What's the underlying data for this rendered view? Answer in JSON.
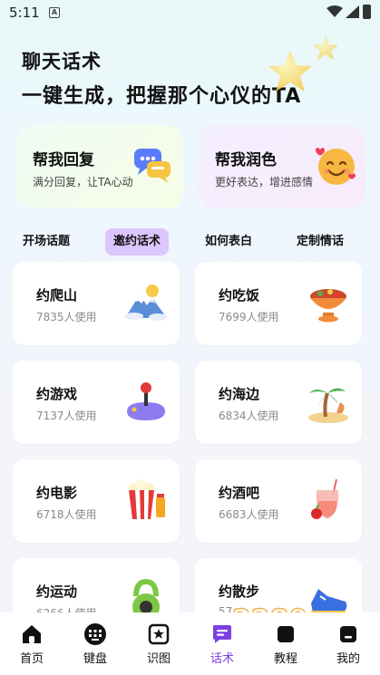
{
  "status": {
    "time": "5:11",
    "a_badge": "A"
  },
  "header": {
    "title": "聊天话术",
    "subtitle": "一键生成，把握那个心仪的TA"
  },
  "features": [
    {
      "title": "帮我回复",
      "subtitle": "满分回复，让TA心动",
      "icon": "chat-bubbles-icon"
    },
    {
      "title": "帮我润色",
      "subtitle": "更好表达，增进感情",
      "icon": "smiling-face-icon"
    }
  ],
  "tabs": [
    {
      "label": "开场话题",
      "active": false
    },
    {
      "label": "邀约话术",
      "active": true
    },
    {
      "label": "如何表白",
      "active": false
    },
    {
      "label": "定制情话",
      "active": false
    }
  ],
  "topics": [
    {
      "title": "约爬山",
      "count": "7835人使用",
      "icon": "mountain-icon"
    },
    {
      "title": "约吃饭",
      "count": "7699人使用",
      "icon": "food-bowl-icon"
    },
    {
      "title": "约游戏",
      "count": "7137人使用",
      "icon": "joystick-icon"
    },
    {
      "title": "约海边",
      "count": "6834人使用",
      "icon": "palm-tree-icon"
    },
    {
      "title": "约电影",
      "count": "6718人使用",
      "icon": "popcorn-icon"
    },
    {
      "title": "约酒吧",
      "count": "6683人使用",
      "icon": "drink-icon"
    },
    {
      "title": "约运动",
      "count": "6266人使用",
      "icon": "kettlebell-icon"
    },
    {
      "title": "约散步",
      "count": "57",
      "icon": "sneaker-icon"
    }
  ],
  "nav": [
    {
      "label": "首页",
      "icon": "home-icon",
      "active": false
    },
    {
      "label": "键盘",
      "icon": "keyboard-icon",
      "active": false
    },
    {
      "label": "识图",
      "icon": "image-scan-icon",
      "active": false
    },
    {
      "label": "话术",
      "icon": "chat-icon",
      "active": true
    },
    {
      "label": "教程",
      "icon": "tutorial-icon",
      "active": false
    },
    {
      "label": "我的",
      "icon": "profile-icon",
      "active": false
    }
  ],
  "watermark": {
    "text1": "2289",
    "text2": ".com",
    "text3": "手游网"
  },
  "colors": {
    "accent": "#7b3fe4",
    "tab_active_bg": "#dcc6ff"
  }
}
